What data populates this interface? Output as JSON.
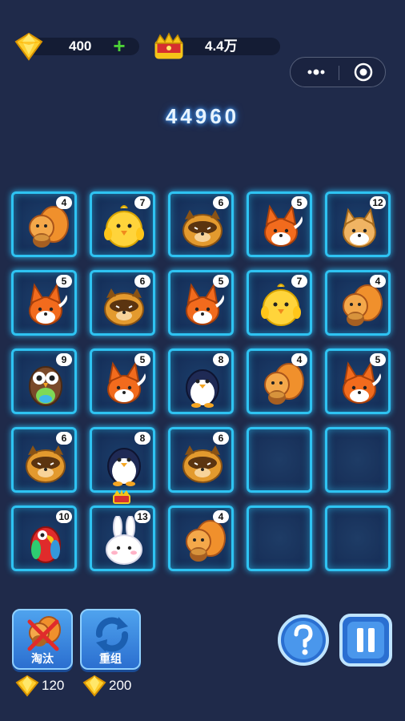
{
  "hud": {
    "gems": "400",
    "crown_score": "4.4万",
    "plus_label": "+"
  },
  "score": "44960",
  "board": {
    "rows": [
      [
        {
          "animal": "squirrel",
          "count": "4"
        },
        {
          "animal": "chick",
          "count": "7"
        },
        {
          "animal": "raccoon",
          "count": "6"
        },
        {
          "animal": "fox",
          "count": "5"
        },
        {
          "animal": "shiba",
          "count": "12"
        }
      ],
      [
        {
          "animal": "fox",
          "count": "5"
        },
        {
          "animal": "raccoon",
          "count": "6"
        },
        {
          "animal": "fox",
          "count": "5"
        },
        {
          "animal": "chick",
          "count": "7"
        },
        {
          "animal": "squirrel",
          "count": "4"
        }
      ],
      [
        {
          "animal": "owl",
          "count": "9"
        },
        {
          "animal": "fox",
          "count": "5"
        },
        {
          "animal": "penguin",
          "count": "8"
        },
        {
          "animal": "squirrel",
          "count": "4"
        },
        {
          "animal": "fox",
          "count": "5"
        }
      ],
      [
        {
          "animal": "raccoon",
          "count": "6"
        },
        {
          "animal": "penguin",
          "count": "8"
        },
        {
          "animal": "raccoon",
          "count": "6"
        },
        {
          "animal": "",
          "count": ""
        },
        {
          "animal": "",
          "count": ""
        }
      ],
      [
        {
          "animal": "parrot",
          "count": "10"
        },
        {
          "animal": "rabbit",
          "count": "13"
        },
        {
          "animal": "squirrel",
          "count": "4"
        },
        {
          "animal": "",
          "count": ""
        },
        {
          "animal": "",
          "count": ""
        }
      ]
    ]
  },
  "tools": {
    "eliminate": {
      "label": "淘汰",
      "cost": "120"
    },
    "reshuffle": {
      "label": "重组",
      "cost": "200"
    }
  },
  "colors": {
    "background": "#1f2a4a",
    "tile_border": "#2ec3f2",
    "button_blue": "#3b86e0",
    "plus_green": "#4cd137"
  },
  "icons": {
    "gem": "gem-icon",
    "crown": "crown-icon",
    "help": "help-icon",
    "pause": "pause-icon",
    "more": "more-icon",
    "close_target": "target-icon"
  }
}
